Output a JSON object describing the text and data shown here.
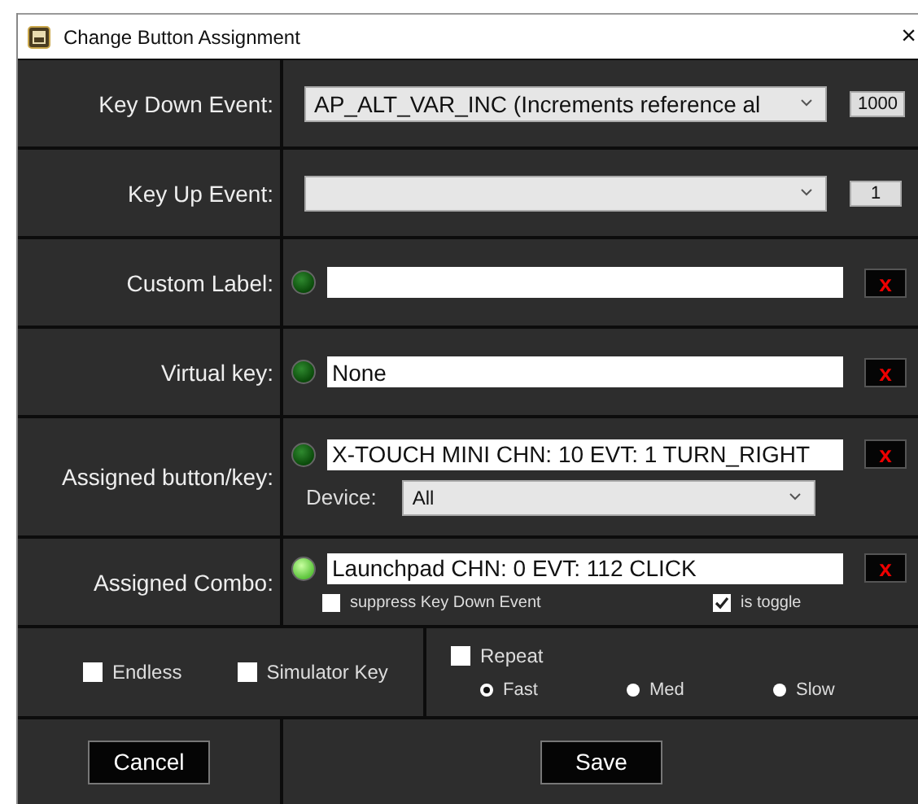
{
  "window": {
    "title": "Change Button Assignment",
    "close": "×"
  },
  "event_rows": [
    {
      "label": "Key Down Event:",
      "value": "AP_ALT_VAR_INC (Increments reference al",
      "number": "1000"
    },
    {
      "label": "Key Up Event:",
      "number": "1"
    }
  ],
  "field_rows": [
    {
      "label": "Custom Label:",
      "lit": false,
      "clear": "x"
    },
    {
      "label": "Virtual key:",
      "lit": false,
      "value": "None",
      "clear": "x"
    },
    {
      "label": "Assigned button/key:",
      "lit": false,
      "value": "X-TOUCH MINI CHN: 10 EVT: 1 TURN_RIGHT",
      "clear": "x",
      "device": {
        "label": "Device:",
        "value": "All"
      }
    },
    {
      "label": "Assigned Combo:",
      "lit": true,
      "value": "Launchpad CHN: 0 EVT: 112 CLICK",
      "clear": "x",
      "options": [
        {
          "label": "suppress Key Down Event",
          "checked": false
        },
        {
          "label": "is toggle",
          "checked": true
        }
      ]
    }
  ],
  "flags": [
    {
      "label": "Endless",
      "checked": false
    },
    {
      "label": "Simulator Key",
      "checked": false
    }
  ],
  "repeat": {
    "label": "Repeat",
    "checked": false,
    "speeds": [
      {
        "label": "Fast",
        "selected": true
      },
      {
        "label": "Med",
        "selected": false
      },
      {
        "label": "Slow",
        "selected": false
      }
    ]
  },
  "buttons": {
    "cancel": "Cancel",
    "save": "Save"
  }
}
